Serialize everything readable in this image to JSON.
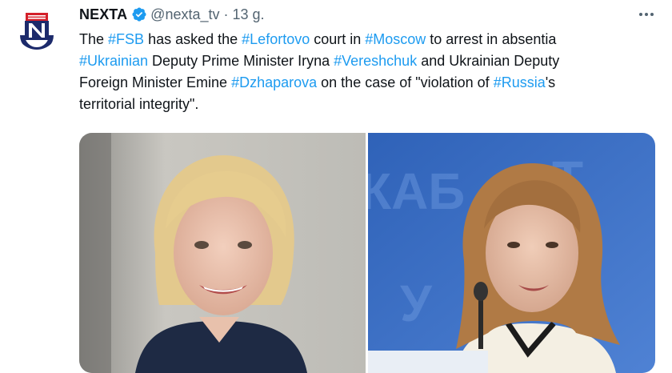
{
  "tweet": {
    "author_name": "NEXTA",
    "handle": "@nexta_tv",
    "separator": "·",
    "time": "13 g.",
    "text_lines": [
      [
        {
          "t": "The ",
          "tag": false
        },
        {
          "t": "#FSB",
          "tag": true
        },
        {
          "t": " has asked the ",
          "tag": false
        },
        {
          "t": "#Lefortovo",
          "tag": true
        },
        {
          "t": " court in ",
          "tag": false
        },
        {
          "t": "#Moscow",
          "tag": true
        },
        {
          "t": " to arrest in absentia",
          "tag": false
        }
      ],
      [
        {
          "t": "#Ukrainian",
          "tag": true
        },
        {
          "t": " Deputy Prime Minister Iryna ",
          "tag": false
        },
        {
          "t": "#Vereshchuk",
          "tag": true
        },
        {
          "t": " and Ukrainian Deputy",
          "tag": false
        }
      ],
      [
        {
          "t": "Foreign Minister Emine ",
          "tag": false
        },
        {
          "t": "#Dzhaparova",
          "tag": true
        },
        {
          "t": " on the case of \"violation of ",
          "tag": false
        },
        {
          "t": "#Russia",
          "tag": true
        },
        {
          "t": "'s",
          "tag": false
        }
      ],
      [
        {
          "t": "territorial integrity\".",
          "tag": false
        }
      ]
    ]
  },
  "icons": {
    "avatar": "nexta-logo-icon",
    "verified": "verified-badge-icon",
    "more": "more-options-icon"
  },
  "colors": {
    "link": "#1d9bf0",
    "text": "#0f1419",
    "secondary": "#536471",
    "brand_red": "#d4202a",
    "verified_blue": "#1d9bf0"
  }
}
